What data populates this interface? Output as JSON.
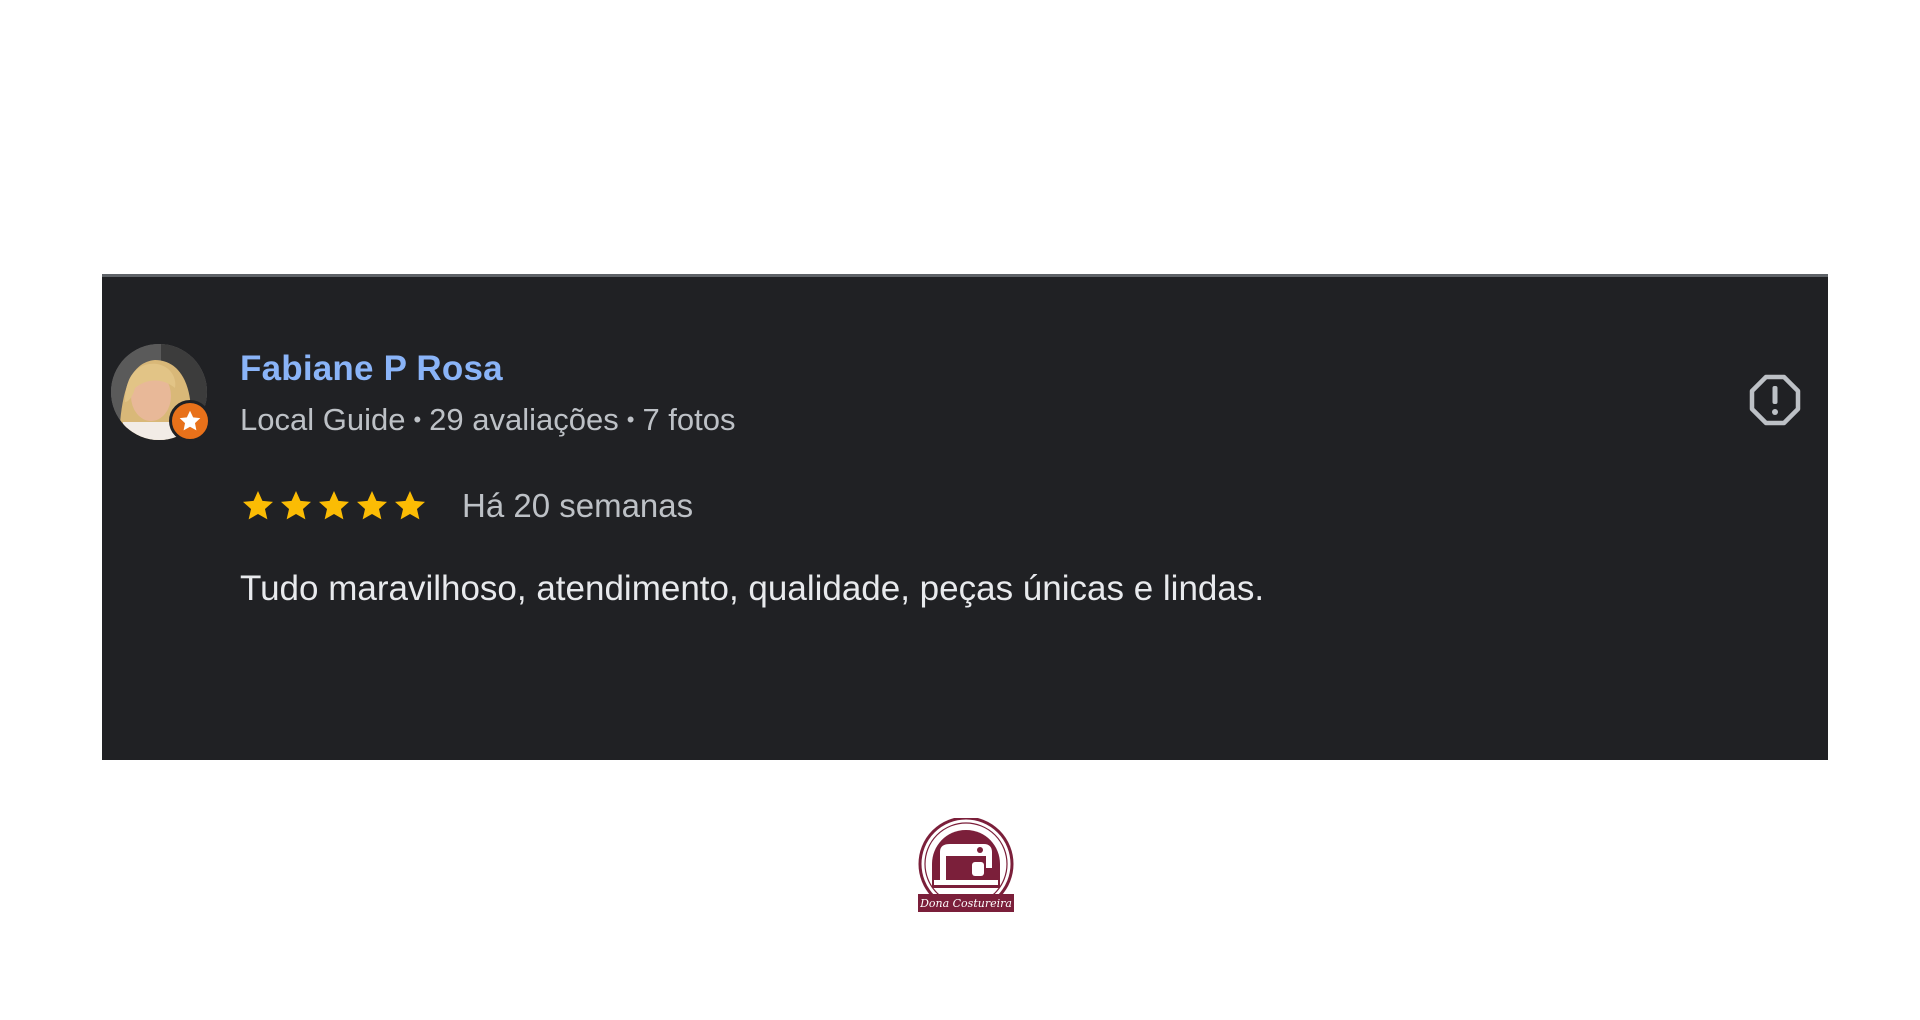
{
  "review": {
    "reviewer_name": "Fabiane P Rosa",
    "reviewer_level": "Local Guide",
    "reviews_count": "29 avaliações",
    "photos_count": "7 fotos",
    "meta_separator": "•",
    "rating": 5,
    "rating_max": 5,
    "date": "Há 20 semanas",
    "text": "Tudo maravilhoso, atendimento, qualidade, peças únicas e lindas."
  },
  "icons": {
    "avatar": "avatar-photo",
    "badge": "local-guide-star-icon",
    "report": "report-exclamation-icon",
    "star": "star-icon"
  },
  "brand": {
    "logo_text": "Dona Costureira"
  },
  "colors": {
    "card_background": "#202124",
    "name": "#8ab4f8",
    "meta": "#bdc1c6",
    "text": "#e8eaed",
    "star": "#fbbc04",
    "badge": "#e8711a",
    "brand": "#7b1f3a"
  }
}
